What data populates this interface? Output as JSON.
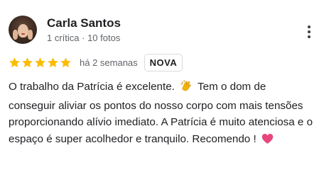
{
  "reviewer": {
    "name": "Carla Santos",
    "meta": "1 crítica · 10 fotos",
    "avatar_icon": "reviewer-photo"
  },
  "review": {
    "rating": 5,
    "max_rating": 5,
    "star_color": "#fbbc04",
    "date": "há 2 semanas",
    "badge": "NOVA",
    "text_1": "O trabalho da Patrícia é excelente.",
    "emoji_1": "clapping-hands",
    "text_2": "Tem o dom de conseguir aliviar os pontos do nosso corpo com mais tensões proporcionando alívio imediato. A Patrícia é muito atenciosa e o espaço é super acolhedor e tranquilo. Recomendo !",
    "emoji_2": "pink-heart"
  },
  "menu": {
    "icon": "more-vertical-icon"
  }
}
